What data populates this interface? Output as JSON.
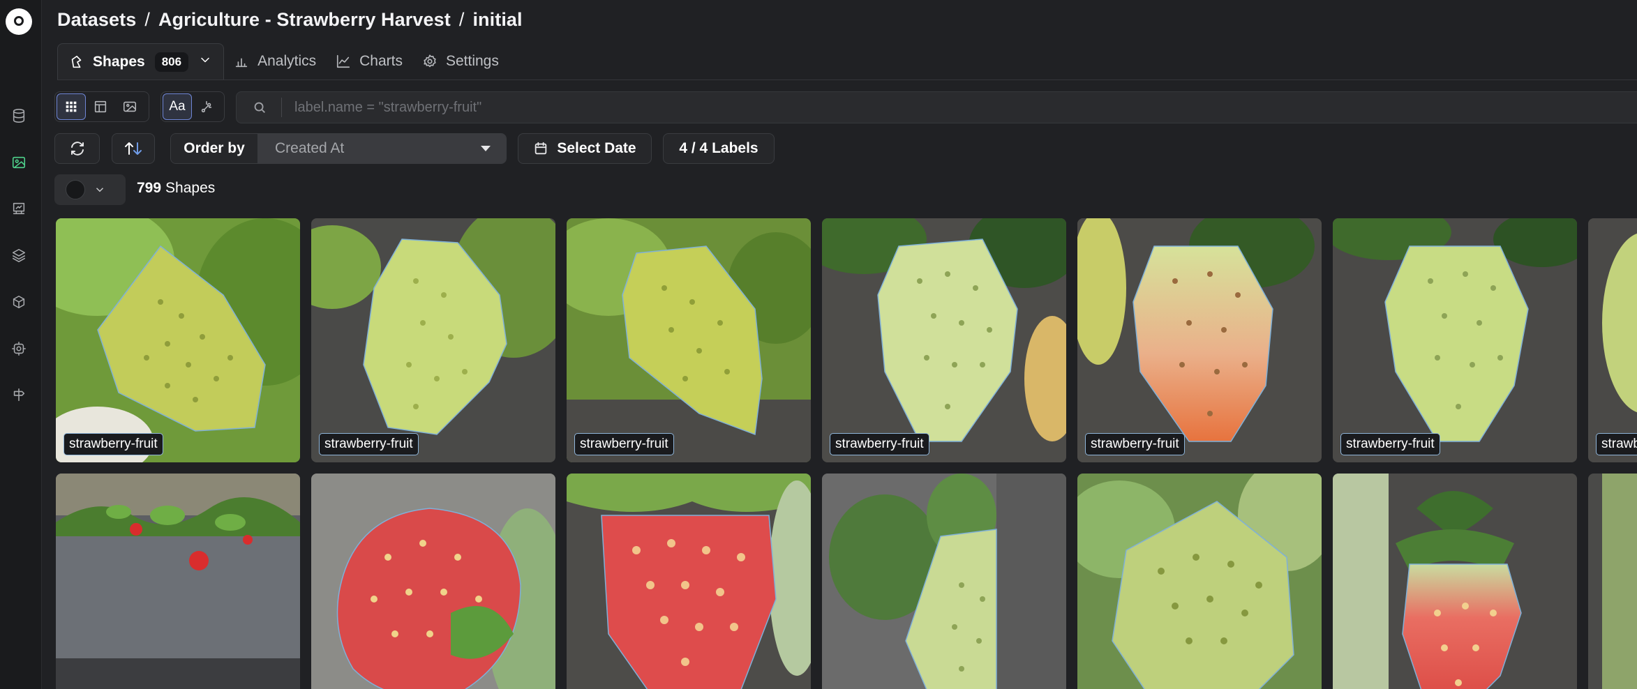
{
  "breadcrumb": {
    "items": [
      "Datasets",
      "Agriculture - Strawberry Harvest",
      "initial"
    ],
    "separator": "/"
  },
  "tabs": [
    {
      "label": "Shapes",
      "count": "806",
      "icon": "shapes-icon",
      "active": true
    },
    {
      "label": "Analytics",
      "icon": "bar-chart-icon"
    },
    {
      "label": "Charts",
      "icon": "line-chart-icon"
    },
    {
      "label": "Settings",
      "icon": "gear-icon"
    }
  ],
  "toolbar": {
    "views": [
      "grid-view-icon",
      "table-view-icon",
      "image-view-icon"
    ],
    "active_view": "grid",
    "text_mode_label": "Aa",
    "search_placeholder": "label.name = \"strawberry-fruit\"",
    "order_by_label": "Order by",
    "order_by_value": "Created At",
    "select_date_label": "Select Date",
    "labels_filter": "4 / 4 Labels"
  },
  "summary": {
    "count": "799",
    "unit": "Shapes"
  },
  "cards": [
    {
      "label": "strawberry-fruit"
    },
    {
      "label": "strawberry-fruit"
    },
    {
      "label": "strawberry-fruit"
    },
    {
      "label": "strawberry-fruit"
    },
    {
      "label": "strawberry-fruit"
    },
    {
      "label": "strawberry-fruit"
    },
    {
      "label": "strawb"
    },
    {
      "label": ""
    },
    {
      "label": ""
    },
    {
      "label": ""
    },
    {
      "label": ""
    },
    {
      "label": ""
    },
    {
      "label": ""
    },
    {
      "label": ""
    }
  ],
  "colors": {
    "background": "#202124",
    "accent_active_nav": "#4fd38c",
    "label_border": "#8fb5d9",
    "annotation_outline": "#7fb0d8"
  }
}
